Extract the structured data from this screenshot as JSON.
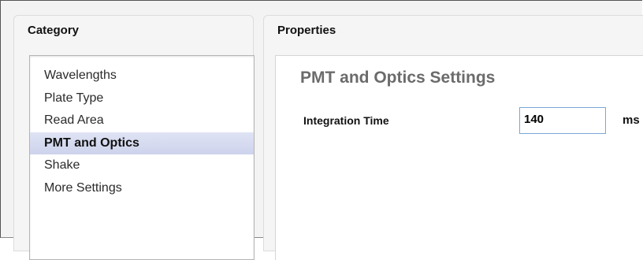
{
  "category_panel": {
    "title": "Category",
    "items": [
      {
        "label": "Wavelengths",
        "selected": false
      },
      {
        "label": "Plate Type",
        "selected": false
      },
      {
        "label": "Read Area",
        "selected": false
      },
      {
        "label": "PMT and Optics",
        "selected": true
      },
      {
        "label": "Shake",
        "selected": false
      },
      {
        "label": "More Settings",
        "selected": false
      }
    ]
  },
  "properties_panel": {
    "title": "Properties",
    "section_heading": "PMT and Optics Settings",
    "integration_time": {
      "label": "Integration Time",
      "value": "140",
      "unit": "ms"
    }
  },
  "colors": {
    "selected_item_background": "#d6dbef",
    "input_border": "#7aa7d8",
    "section_heading": "#6b6b6b"
  }
}
